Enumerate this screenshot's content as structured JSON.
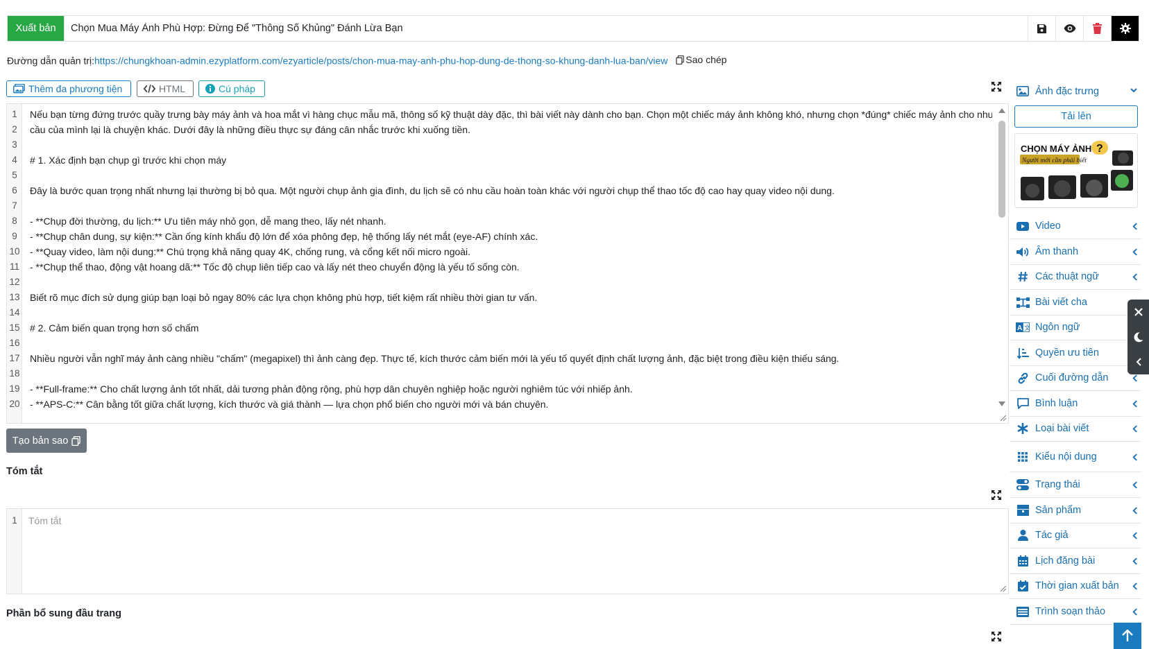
{
  "topbar": {
    "publish_label": "Xuất bản",
    "title_value": "Chọn Mua Máy Ảnh Phù Hợp: Đừng Để \"Thông Số Khủng\" Đánh Lừa Bạn",
    "icons": [
      "save-icon",
      "eye-icon",
      "trash-icon",
      "gear-icon"
    ]
  },
  "admin_path": {
    "label": "Đường dẫn quản trị:",
    "url": "https://chungkhoan-admin.ezyplatform.com/ezyarticle/posts/chon-mua-may-anh-phu-hop-dung-de-thong-so-khung-danh-lua-ban/view",
    "copy_label": "Sao chép"
  },
  "editor_toolbar": {
    "media_label": "Thêm đa phương tiện",
    "html_label": "HTML",
    "syntax_label": "Cú pháp"
  },
  "editor": {
    "lines": [
      {
        "n": "1",
        "text": "Nếu bạn từng đứng trước quầy trưng bày máy ảnh và hoa mắt vì hàng chục mẫu mã, thông số kỹ thuật dày đặc, thì bài viết này dành cho bạn. Chọn một chiếc máy ảnh không khó, nhưng chọn *đúng* chiếc máy ảnh cho nhu"
      },
      {
        "n": "",
        "text": "cầu của mình lại là chuyện khác. Dưới đây là những điều thực sự đáng cân nhắc trước khi xuống tiền."
      },
      {
        "n": "3",
        "text": ""
      },
      {
        "n": "4",
        "text": "# 1. Xác định bạn chụp gì trước khi chọn máy"
      },
      {
        "n": "5",
        "text": ""
      },
      {
        "n": "6",
        "text": "Đây là bước quan trọng nhất nhưng lại thường bị bỏ qua. Một người chụp ảnh gia đình, du lịch sẽ có nhu cầu hoàn toàn khác với người chụp thể thao tốc độ cao hay quay video nội dung."
      },
      {
        "n": "7",
        "text": ""
      },
      {
        "n": "8",
        "text": "- **Chụp đời thường, du lịch:** Ưu tiên máy nhỏ gọn, dễ mang theo, lấy nét nhanh."
      },
      {
        "n": "9",
        "text": "- **Chụp chân dung, sự kiện:** Cần ống kính khẩu độ lớn để xóa phông đẹp, hệ thống lấy nét mắt (eye-AF) chính xác."
      },
      {
        "n": "10",
        "text": "- **Quay video, làm nội dung:** Chú trọng khả năng quay 4K, chống rung, và cổng kết nối micro ngoài."
      },
      {
        "n": "11",
        "text": "- **Chụp thể thao, động vật hoang dã:** Tốc độ chụp liên tiếp cao và lấy nét theo chuyển động là yếu tố sống còn."
      },
      {
        "n": "12",
        "text": ""
      },
      {
        "n": "13",
        "text": "Biết rõ mục đích sử dụng giúp bạn loại bỏ ngay 80% các lựa chọn không phù hợp, tiết kiệm rất nhiều thời gian tư vấn."
      },
      {
        "n": "14",
        "text": ""
      },
      {
        "n": "15",
        "text": "# 2. Cảm biến quan trọng hơn số chấm"
      },
      {
        "n": "16",
        "text": ""
      },
      {
        "n": "17",
        "text": "Nhiều người vẫn nghĩ máy ảnh càng nhiều \"chấm\" (megapixel) thì ảnh càng đẹp. Thực tế, kích thước cảm biến mới là yếu tố quyết định chất lượng ảnh, đặc biệt trong điều kiện thiếu sáng."
      },
      {
        "n": "18",
        "text": ""
      },
      {
        "n": "19",
        "text": "- **Full-frame:** Cho chất lượng ảnh tốt nhất, dải tương phản động rộng, phù hợp dân chuyên nghiệp hoặc người nghiêm túc với nhiếp ảnh."
      },
      {
        "n": "20",
        "text": "- **APS-C:** Cân bằng tốt giữa chất lượng, kích thước và giá thành — lựa chọn phổ biến cho người mới và bán chuyên."
      }
    ]
  },
  "clone_label": "Tạo bản sao",
  "summary": {
    "heading": "Tóm tắt",
    "line_number": "1",
    "placeholder": "Tóm tắt"
  },
  "header_addon": {
    "heading": "Phần bổ sung đầu trang"
  },
  "sidebar": {
    "featured_image": {
      "label": "Ảnh đặc trưng",
      "upload_label": "Tải lên",
      "image_title": "CHỌN MÁY ẢNH",
      "image_subtitle": "Người mới cần phải biết"
    },
    "items": [
      {
        "label": "Video",
        "icon": "video-icon"
      },
      {
        "label": "Âm thanh",
        "icon": "volume-icon"
      },
      {
        "label": "Các thuật ngữ",
        "icon": "hashtag-icon"
      },
      {
        "label": "Bài viết cha",
        "icon": "sitemap-icon"
      },
      {
        "label": "Ngôn ngữ",
        "icon": "language-icon"
      },
      {
        "label": "Quyền ưu tiên",
        "icon": "sort-priority-icon"
      },
      {
        "label": "Cuối đường dẫn",
        "icon": "link-icon"
      },
      {
        "label": "Bình luận",
        "icon": "comment-icon"
      },
      {
        "label": "Loại bài viết",
        "icon": "asterisk-icon"
      },
      {
        "label": "Kiểu nội dung",
        "icon": "grid-icon"
      },
      {
        "label": "Trạng thái",
        "icon": "toggle-icon"
      },
      {
        "label": "Sản phẩm",
        "icon": "box-icon"
      },
      {
        "label": "Tác giả",
        "icon": "user-icon"
      },
      {
        "label": "Lịch đăng bài",
        "icon": "calendar-icon"
      },
      {
        "label": "Thời gian xuất bản",
        "icon": "calendar-check-icon"
      },
      {
        "label": "Trình soạn thảo",
        "icon": "editor-icon"
      }
    ]
  },
  "colors": {
    "publish_green": "#28a745",
    "link_blue": "#1a7bbf",
    "sidebar_blue": "#1a6fb0",
    "delete_red": "#dc3545",
    "clone_gray": "#6c757d"
  }
}
